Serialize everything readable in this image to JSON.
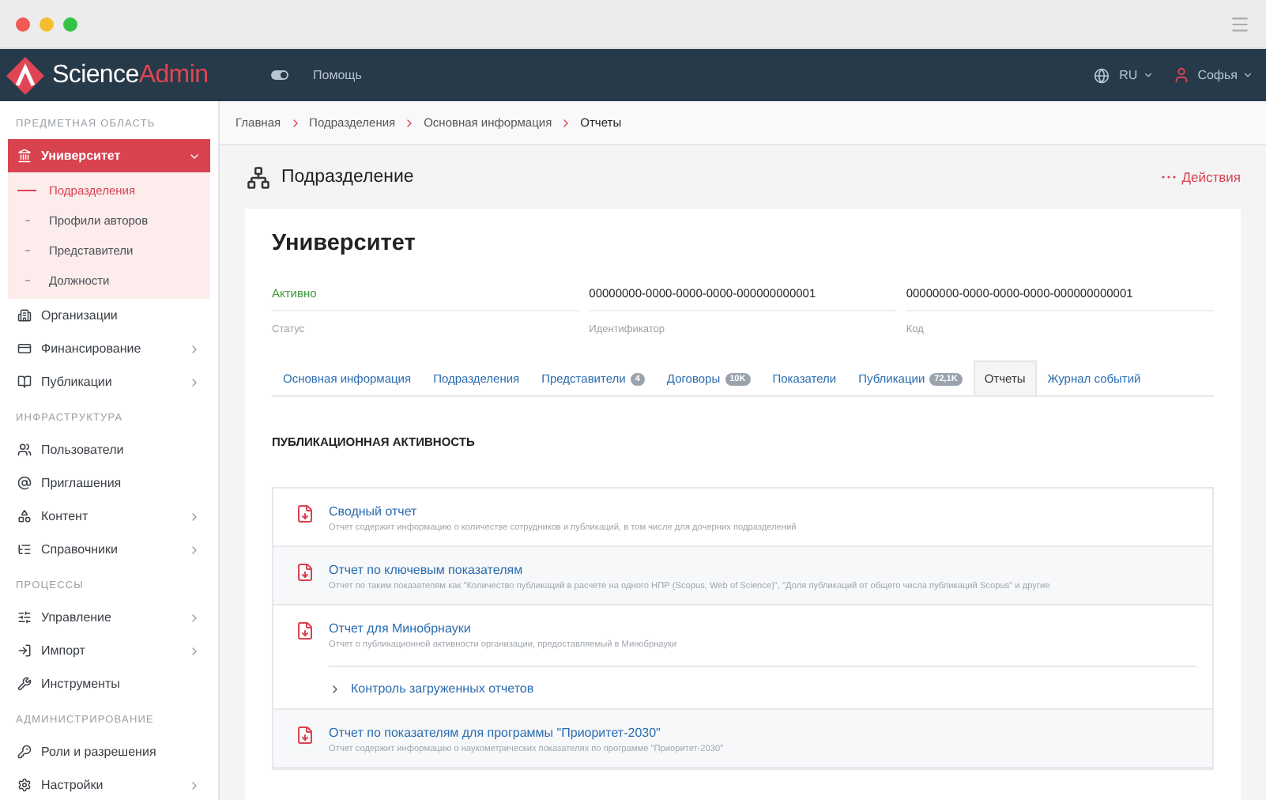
{
  "navbar": {
    "logo_first": "Science",
    "logo_second": "Admin",
    "help": "Помощь",
    "language": "RU",
    "user": "Софья"
  },
  "sidebar": {
    "sections": [
      {
        "label": "ПРЕДМЕТНАЯ ОБЛАСТЬ",
        "items": [
          {
            "label": "Университет",
            "has_submenu": true,
            "selected": true,
            "expanded": true,
            "children": [
              {
                "label": "Подразделения",
                "selected": true
              },
              {
                "label": "Профили авторов",
                "selected": false
              },
              {
                "label": "Представители",
                "selected": false
              },
              {
                "label": "Должности",
                "selected": false
              }
            ]
          },
          {
            "label": "Организации",
            "has_submenu": false,
            "selected": false
          },
          {
            "label": "Финансирование",
            "has_submenu": true,
            "selected": false,
            "expanded": false
          },
          {
            "label": "Публикации",
            "has_submenu": true,
            "selected": false,
            "expanded": false
          }
        ]
      },
      {
        "label": "ИНФРАСТРУКТУРА",
        "items": [
          {
            "label": "Пользователи",
            "has_submenu": false,
            "selected": false
          },
          {
            "label": "Приглашения",
            "has_submenu": false,
            "selected": false
          },
          {
            "label": "Контент",
            "has_submenu": true,
            "selected": false,
            "expanded": false
          },
          {
            "label": "Справочники",
            "has_submenu": true,
            "selected": false,
            "expanded": false
          }
        ]
      },
      {
        "label": "ПРОЦЕССЫ",
        "items": [
          {
            "label": "Управление",
            "has_submenu": true,
            "selected": false,
            "expanded": false
          },
          {
            "label": "Импорт",
            "has_submenu": true,
            "selected": false,
            "expanded": false
          },
          {
            "label": "Инструменты",
            "has_submenu": false,
            "selected": false
          }
        ]
      },
      {
        "label": "АДМИНИСТРИРОВАНИЕ",
        "items": [
          {
            "label": "Роли и разрешения",
            "has_submenu": false,
            "selected": false
          },
          {
            "label": "Настройки",
            "has_submenu": true,
            "selected": false,
            "expanded": false
          }
        ]
      }
    ]
  },
  "breadcrumbs": [
    "Главная",
    "Подразделения",
    "Основная информация",
    "Отчеты"
  ],
  "page": {
    "title": "Подразделение",
    "actions": "Действия"
  },
  "card": {
    "title": "Университет",
    "fields": [
      {
        "kind": "status",
        "value": "Активно",
        "label": "Статус"
      },
      {
        "kind": "text",
        "value": "00000000-0000-0000-0000-000000000001",
        "label": "Идентификатор"
      },
      {
        "kind": "text",
        "value": "00000000-0000-0000-0000-000000000001",
        "label": "Код"
      }
    ],
    "tabs": [
      {
        "label": "Основная информация",
        "selected": false
      },
      {
        "label": "Подразделения",
        "selected": false
      },
      {
        "label": "Представители",
        "badge": "4",
        "selected": false
      },
      {
        "label": "Договоры",
        "badge": "10K",
        "selected": false
      },
      {
        "label": "Показатели",
        "selected": false
      },
      {
        "label": "Публикации",
        "badge": "72,1K",
        "selected": false
      },
      {
        "label": "Отчеты",
        "selected": true
      },
      {
        "label": "Журнал событий",
        "selected": false
      }
    ],
    "section_title": "ПУБЛИКАЦИОННАЯ АКТИВНОСТЬ",
    "reports": [
      {
        "title": "Сводный отчет",
        "description": "Отчет содержит информацию о количестве сотрудников и публикаций, в том числе для дочерних подразделений"
      },
      {
        "title": "Отчет по ключевым показателям",
        "description": "Отчет по таким показателям как \"Количество публикаций в расчете на одного НПР (Scopus, Web of Science)\", \"Доля публикаций от общего числа публикаций Scopus\" и другие"
      },
      {
        "title": "Отчет для Минобрнауки",
        "description": "Отчет о публикационной активности организации, предоставляемый в Минобрнауки",
        "sublink": {
          "label": "Контроль загруженных отчетов",
          "expanded": false
        }
      },
      {
        "title": "Отчет по показателям для программы \"Приоритет-2030\"",
        "description": "Отчет содержит информацию о наукометрических показателях по программе \"Приоритет-2030\""
      }
    ]
  }
}
